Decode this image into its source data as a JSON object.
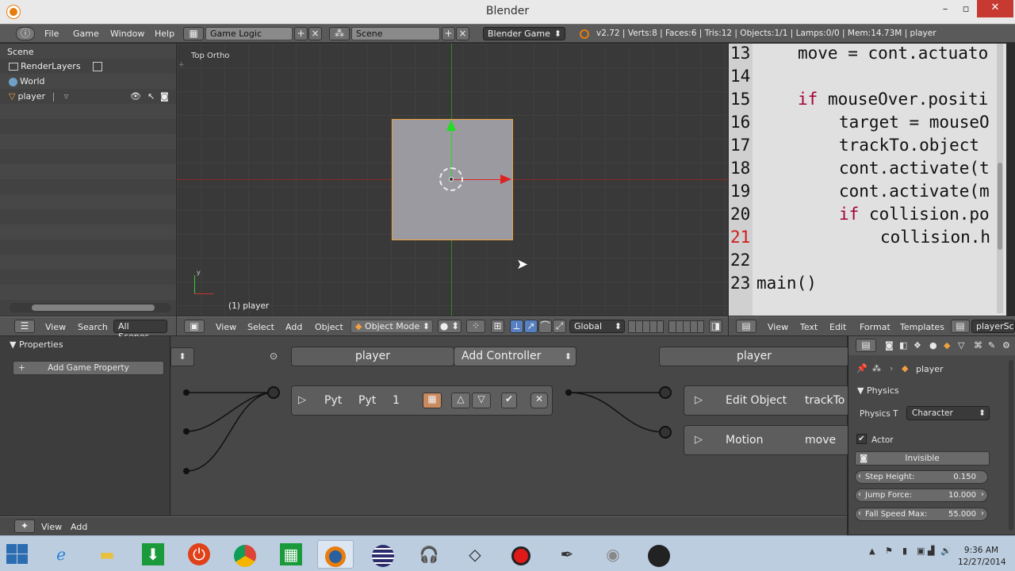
{
  "window": {
    "title": "Blender"
  },
  "info_header": {
    "menus": [
      "File",
      "Game",
      "Window",
      "Help"
    ],
    "screen_layout": "Game Logic",
    "scene": "Scene",
    "engine": "Blender Game",
    "stats": "v2.72 | Verts:8 | Faces:6 | Tris:12 | Objects:1/1 | Lamps:0/0 | Mem:14.73M | player"
  },
  "outliner": {
    "header": "Scene",
    "items": [
      "RenderLayers",
      "World",
      "player"
    ],
    "footer_menus": [
      "View",
      "Search"
    ],
    "filter": "All Scenes"
  },
  "view3d": {
    "label": "Top Ortho",
    "object_label": "(1) player",
    "menus": [
      "View",
      "Select",
      "Add",
      "Object"
    ],
    "mode": "Object Mode",
    "orientation": "Global"
  },
  "text_editor": {
    "lines": [
      {
        "num": "13",
        "indent": "    ",
        "code": "move = cont.actuato"
      },
      {
        "num": "14",
        "indent": "",
        "code": ""
      },
      {
        "num": "15",
        "indent": "    ",
        "code": "if mouseOver.positi"
      },
      {
        "num": "16",
        "indent": "        ",
        "code": "target = mouseO"
      },
      {
        "num": "17",
        "indent": "        ",
        "code": "trackTo.object "
      },
      {
        "num": "18",
        "indent": "        ",
        "code": "cont.activate(t"
      },
      {
        "num": "19",
        "indent": "        ",
        "code": "cont.activate(m"
      },
      {
        "num": "20",
        "indent": "        ",
        "code": "if collision.po"
      },
      {
        "num": "21",
        "indent": "            ",
        "code": "collision.h"
      },
      {
        "num": "22",
        "indent": "",
        "code": ""
      },
      {
        "num": "23",
        "indent": "",
        "code": "main()"
      }
    ],
    "menus": [
      "View",
      "Text",
      "Edit",
      "Format",
      "Templates"
    ],
    "text_name": "playerSc"
  },
  "properties_panel": {
    "title": "Properties",
    "add_property": "Add Game Property"
  },
  "logic_editor": {
    "object_name_left": "player",
    "add_controller": "Add Controller",
    "object_name_right": "player",
    "controller": {
      "type": "Pyt",
      "name": "Pyt",
      "state": "1"
    },
    "actuators": [
      {
        "type": "Edit Object",
        "name": "trackTo"
      },
      {
        "type": "Motion",
        "name": "move"
      }
    ],
    "footer_menus": [
      "View",
      "Add"
    ]
  },
  "physics_panel": {
    "object": "player",
    "section": "Physics",
    "physics_type_label": "Physics T",
    "physics_type": "Character",
    "actor_label": "Actor",
    "invisible_label": "Invisible",
    "step_height_label": "Step Height:",
    "step_height": "0.150",
    "jump_force_label": "Jump Force:",
    "jump_force": "10.000",
    "fall_speed_label": "Fall Speed Max:",
    "fall_speed": "55.000"
  },
  "taskbar": {
    "time": "9:36 AM",
    "date": "12/27/2014",
    "icons": [
      "ie-icon",
      "explorer-icon",
      "download-icon",
      "power-icon",
      "chrome-icon",
      "store-icon",
      "blender-icon",
      "eclipse-icon",
      "headphones-icon",
      "unity-icon",
      "record-icon",
      "inkscape-icon",
      "gimp-icon",
      "obs-icon"
    ]
  }
}
